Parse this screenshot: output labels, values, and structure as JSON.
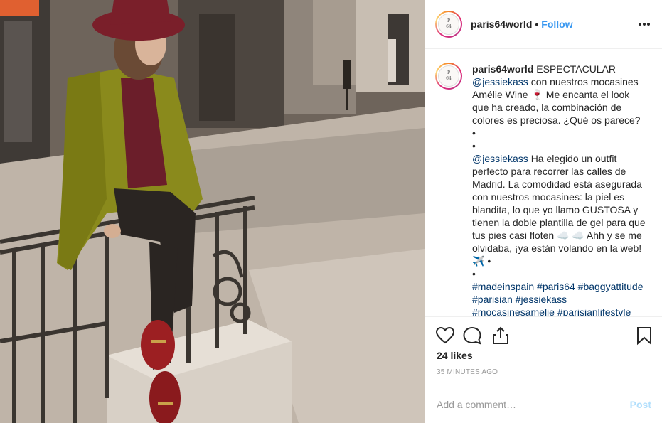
{
  "post": {
    "image_alt": "Woman in green coat and burgundy hat sitting on iron railing"
  },
  "header": {
    "username": "paris64world",
    "separator": "•",
    "follow_label": "Follow",
    "more_icon": "more-options-icon"
  },
  "avatar": {
    "logo_top": "P",
    "logo_bottom": "64"
  },
  "caption": {
    "username": "paris64world",
    "p1_text1": "ESPECTACULAR",
    "p1_mention": "@jessiekass",
    "p1_text2": "con nuestros mocasines Amélie Wine 🍷 Me encanta el look que ha creado, la combinación de colores es preciosa. ¿Qué os parece?",
    "bullet1": "•",
    "bullet2": "•",
    "p2_mention": "@jessiekass",
    "p2_text": "Ha elegido un outfit perfecto para recorrer las calles de Madrid. La comodidad está asegurada con nuestros mocasines: la piel es blandita, lo que yo llamo GUSTOSA y tienen la doble plantilla de gel para que tus pies casi floten ☁️ ☁️ Ahh y se me olvidaba, ¡ya están volando en la web! ✈️ •",
    "bullet3": "•",
    "hashtags": "#madeinspain #paris64 #baggyattitude #parisian #jessiekass",
    "hashtags_more": "#mocasinesamelie #parisianlifestyle"
  },
  "actions": {
    "like_icon": "heart-icon",
    "comment_icon": "comment-icon",
    "share_icon": "share-icon",
    "save_icon": "bookmark-icon",
    "likes": "24 likes",
    "timestamp": "35 MINUTES AGO"
  },
  "comment_box": {
    "placeholder": "Add a comment…",
    "post_label": "Post"
  },
  "colors": {
    "link_blue": "#3897f0",
    "mention_blue": "#003569",
    "post_disabled": "#b2dffc",
    "border": "#efefef",
    "muted": "#999999"
  }
}
